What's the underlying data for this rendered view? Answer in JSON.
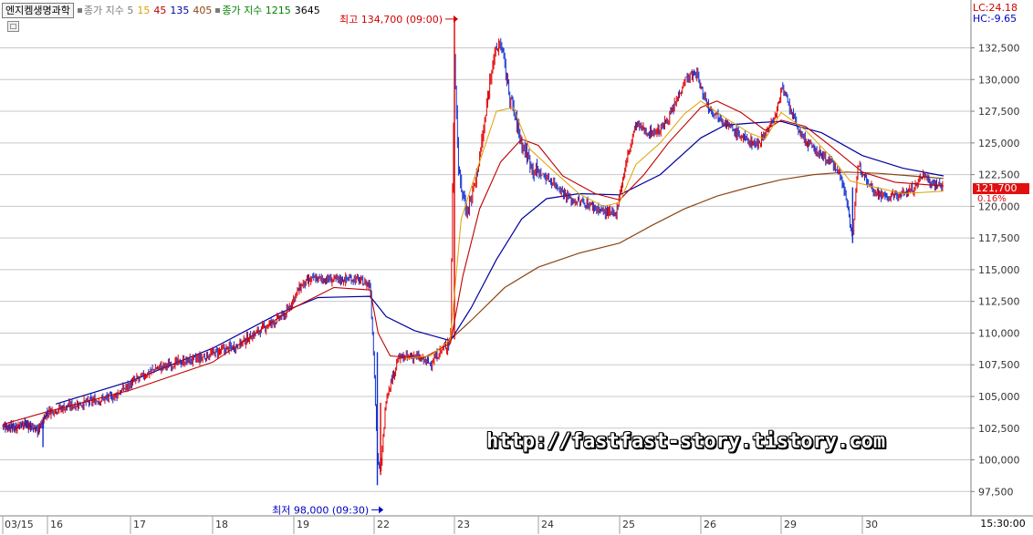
{
  "header": {
    "stock_name": "엔지켐생명과학",
    "ma_label": "종가 지수 5",
    "ma_periods": [
      {
        "value": "15",
        "color": "#e0a000"
      },
      {
        "value": "45",
        "color": "#c00000"
      },
      {
        "value": "135",
        "color": "#0000a0"
      },
      {
        "value": "405",
        "color": "#8b4513"
      }
    ],
    "ma2_label": "종가 지수 1215",
    "ma2_value": "3645"
  },
  "right_panel": {
    "lc": "LC:24.18",
    "hc": "HC:-9.65",
    "current_price": "121,700",
    "change_pct": "0.16%",
    "time": "15:30:00"
  },
  "annotations": {
    "high": "최고 134,700 (09:00)",
    "low": "최저 98,000 (09:30)"
  },
  "watermark": "http://fastfast-story.tistory.com",
  "colors": {
    "up_candle": "#e00000",
    "down_candle": "#1030d0",
    "ma15": "#e0a000",
    "ma45": "#c00000",
    "ma135": "#0000a0",
    "ma405": "#8b4513",
    "grid": "#c8c8c8"
  },
  "chart_data": {
    "type": "candlestick",
    "y_ticks": [
      132500,
      130000,
      127500,
      125000,
      122500,
      120000,
      117500,
      115000,
      112500,
      110000,
      107500,
      105000,
      102500,
      100000,
      97500
    ],
    "y_tick_labels": [
      "132,500",
      "130,000",
      "127,500",
      "125,000",
      "122,500",
      "120,000",
      "117,500",
      "115,000",
      "112,500",
      "110,000",
      "107,500",
      "105,000",
      "102,500",
      "100,000",
      "97,500"
    ],
    "ylim": [
      96300,
      135700
    ],
    "x_labels": [
      "03/15",
      "16",
      "17",
      "18",
      "19",
      "22",
      "23",
      "24",
      "25",
      "26",
      "29",
      "30"
    ],
    "day_close_path": [
      [
        0.0,
        102700
      ],
      [
        0.3,
        102600
      ],
      [
        0.45,
        102900
      ],
      [
        0.6,
        102700
      ],
      [
        0.8,
        102300
      ],
      [
        1.0,
        103800
      ],
      [
        1.3,
        104300
      ],
      [
        1.6,
        104700
      ],
      [
        1.8,
        105000
      ],
      [
        2.0,
        106000
      ],
      [
        2.3,
        107200
      ],
      [
        2.6,
        107700
      ],
      [
        2.85,
        108000
      ],
      [
        3.0,
        108400
      ],
      [
        3.3,
        109000
      ],
      [
        3.6,
        110300
      ],
      [
        3.9,
        111500
      ],
      [
        4.0,
        112800
      ],
      [
        4.1,
        113800
      ],
      [
        4.25,
        114300
      ],
      [
        4.5,
        114200
      ],
      [
        4.75,
        114300
      ],
      [
        4.95,
        113800
      ],
      [
        5.0,
        107500
      ],
      [
        5.04,
        100300
      ],
      [
        5.08,
        99000
      ],
      [
        5.15,
        105000
      ],
      [
        5.3,
        108000
      ],
      [
        5.5,
        108200
      ],
      [
        5.7,
        107600
      ],
      [
        5.95,
        109500
      ],
      [
        6.0,
        132000
      ],
      [
        6.05,
        122500
      ],
      [
        6.15,
        119500
      ],
      [
        6.25,
        122000
      ],
      [
        6.35,
        126000
      ],
      [
        6.45,
        131500
      ],
      [
        6.55,
        133000
      ],
      [
        6.65,
        129000
      ],
      [
        6.8,
        125000
      ],
      [
        6.95,
        122800
      ],
      [
        7.0,
        122700
      ],
      [
        7.2,
        121800
      ],
      [
        7.4,
        120500
      ],
      [
        7.6,
        120200
      ],
      [
        7.8,
        119600
      ],
      [
        7.95,
        119300
      ],
      [
        8.0,
        121000
      ],
      [
        8.1,
        124000
      ],
      [
        8.2,
        126500
      ],
      [
        8.35,
        125800
      ],
      [
        8.5,
        126000
      ],
      [
        8.65,
        127500
      ],
      [
        8.8,
        130000
      ],
      [
        8.95,
        130500
      ],
      [
        9.0,
        129300
      ],
      [
        9.1,
        127800
      ],
      [
        9.25,
        127000
      ],
      [
        9.4,
        126000
      ],
      [
        9.55,
        125300
      ],
      [
        9.7,
        124900
      ],
      [
        9.85,
        126200
      ],
      [
        9.95,
        127500
      ],
      [
        10.0,
        129500
      ],
      [
        10.1,
        127800
      ],
      [
        10.25,
        125500
      ],
      [
        10.4,
        124500
      ],
      [
        10.55,
        123800
      ],
      [
        10.7,
        123000
      ],
      [
        10.8,
        120700
      ],
      [
        10.88,
        117600
      ],
      [
        10.95,
        123400
      ],
      [
        11.0,
        122800
      ],
      [
        11.15,
        121200
      ],
      [
        11.3,
        120700
      ],
      [
        11.5,
        121000
      ],
      [
        11.65,
        121500
      ],
      [
        11.75,
        122600
      ],
      [
        11.85,
        121800
      ],
      [
        12.0,
        121700
      ]
    ],
    "ma15_path": [
      [
        5.4,
        108000
      ],
      [
        5.7,
        108200
      ],
      [
        5.95,
        109500
      ],
      [
        6.08,
        119000
      ],
      [
        6.2,
        121500
      ],
      [
        6.35,
        124500
      ],
      [
        6.5,
        127500
      ],
      [
        6.7,
        127800
      ],
      [
        6.9,
        124500
      ],
      [
        7.2,
        122700
      ],
      [
        7.5,
        121000
      ],
      [
        7.8,
        120000
      ],
      [
        8.0,
        120300
      ],
      [
        8.2,
        123300
      ],
      [
        8.5,
        125000
      ],
      [
        8.8,
        127300
      ],
      [
        9.0,
        128300
      ],
      [
        9.3,
        127000
      ],
      [
        9.6,
        125800
      ],
      [
        9.8,
        125300
      ],
      [
        10.0,
        127400
      ],
      [
        10.3,
        126000
      ],
      [
        10.6,
        124000
      ],
      [
        10.85,
        122000
      ],
      [
        11.1,
        121600
      ],
      [
        11.5,
        121000
      ],
      [
        12.0,
        121200
      ]
    ],
    "ma45_path": [
      [
        0.0,
        102800
      ],
      [
        1.0,
        103800
      ],
      [
        2.0,
        105500
      ],
      [
        3.0,
        107700
      ],
      [
        4.0,
        112000
      ],
      [
        4.5,
        113600
      ],
      [
        4.95,
        113400
      ],
      [
        5.05,
        110000
      ],
      [
        5.2,
        108200
      ],
      [
        5.6,
        108000
      ],
      [
        5.95,
        109200
      ],
      [
        6.1,
        114500
      ],
      [
        6.3,
        119800
      ],
      [
        6.55,
        123500
      ],
      [
        6.8,
        125300
      ],
      [
        7.0,
        124800
      ],
      [
        7.3,
        122400
      ],
      [
        7.7,
        121000
      ],
      [
        8.0,
        120500
      ],
      [
        8.3,
        122500
      ],
      [
        8.6,
        125000
      ],
      [
        9.0,
        127800
      ],
      [
        9.2,
        128300
      ],
      [
        9.5,
        127400
      ],
      [
        9.8,
        126000
      ],
      [
        10.0,
        126800
      ],
      [
        10.3,
        126300
      ],
      [
        10.6,
        124800
      ],
      [
        11.0,
        122700
      ],
      [
        11.4,
        121900
      ],
      [
        12.0,
        121600
      ]
    ],
    "ma135_path": [
      [
        1.1,
        104400
      ],
      [
        2.0,
        106200
      ],
      [
        3.0,
        108800
      ],
      [
        3.8,
        111500
      ],
      [
        4.3,
        112800
      ],
      [
        4.95,
        112900
      ],
      [
        5.15,
        111300
      ],
      [
        5.5,
        110200
      ],
      [
        5.95,
        109400
      ],
      [
        6.2,
        112000
      ],
      [
        6.5,
        115800
      ],
      [
        6.8,
        119000
      ],
      [
        7.1,
        120600
      ],
      [
        7.5,
        121000
      ],
      [
        8.0,
        120900
      ],
      [
        8.5,
        122500
      ],
      [
        9.0,
        125400
      ],
      [
        9.3,
        126400
      ],
      [
        9.7,
        126600
      ],
      [
        10.0,
        126700
      ],
      [
        10.5,
        125800
      ],
      [
        11.0,
        124000
      ],
      [
        11.5,
        123000
      ],
      [
        12.0,
        122400
      ]
    ],
    "ma405_path": [
      [
        5.9,
        109200
      ],
      [
        6.2,
        111000
      ],
      [
        6.6,
        113600
      ],
      [
        7.0,
        115200
      ],
      [
        7.5,
        116300
      ],
      [
        8.0,
        117100
      ],
      [
        8.4,
        118500
      ],
      [
        8.8,
        119800
      ],
      [
        9.2,
        120800
      ],
      [
        9.6,
        121500
      ],
      [
        10.0,
        122100
      ],
      [
        10.4,
        122500
      ],
      [
        10.8,
        122700
      ],
      [
        11.2,
        122600
      ],
      [
        11.6,
        122400
      ],
      [
        12.0,
        122200
      ]
    ],
    "high": {
      "day": 6.0,
      "value": 134700
    },
    "low": {
      "day": 5.07,
      "value": 98000
    }
  }
}
